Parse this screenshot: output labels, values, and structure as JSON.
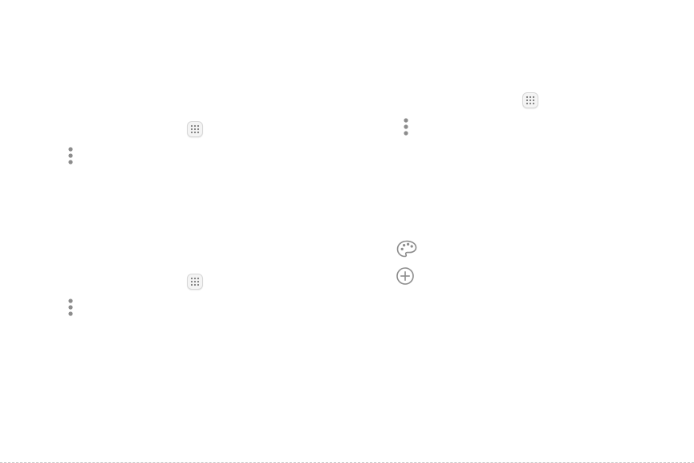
{
  "colors": {
    "icon_gray": "#8c8c8c",
    "apps_button_background": "#f4f4f4",
    "apps_button_border": "#d7d7d7",
    "dashed_rule": "#c9c9c9"
  },
  "icons": {
    "apps": "apps-grid-icon",
    "more_options": "more-options-icon",
    "wallpapers_themes": "palette-icon",
    "add": "add-circle-icon"
  }
}
